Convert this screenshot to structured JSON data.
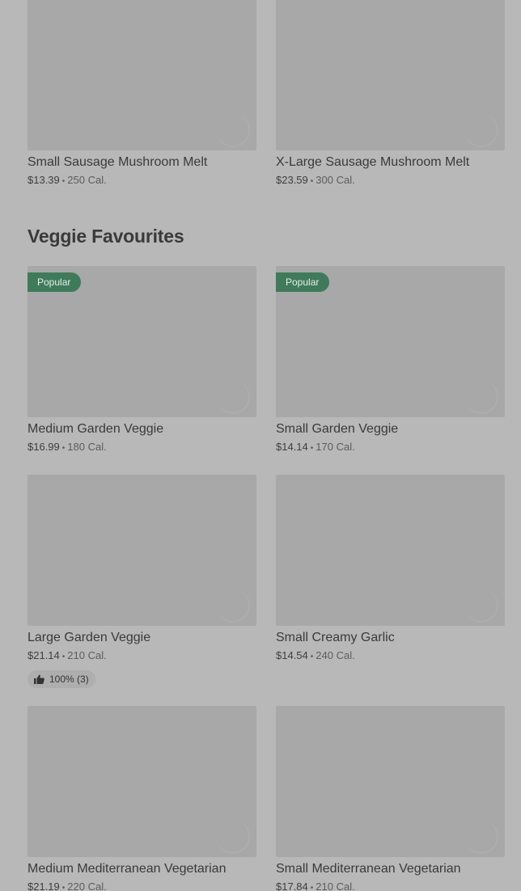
{
  "top_items": [
    {
      "name": "Small Sausage Mushroom Melt",
      "price": "$13.39",
      "calories": "250 Cal."
    },
    {
      "name": "X-Large Sausage Mushroom Melt",
      "price": "$23.59",
      "calories": "300 Cal."
    }
  ],
  "section": {
    "title": "Veggie Favourites"
  },
  "veggie_items": [
    {
      "name": "Medium Garden Veggie",
      "price": "$16.99",
      "calories": "180 Cal.",
      "badge": "Popular"
    },
    {
      "name": "Small Garden Veggie",
      "price": "$14.14",
      "calories": "170 Cal.",
      "badge": "Popular"
    },
    {
      "name": "Large Garden Veggie",
      "price": "$21.14",
      "calories": "210 Cal.",
      "rating": "100% (3)"
    },
    {
      "name": "Small Creamy Garlic",
      "price": "$14.54",
      "calories": "240 Cal."
    },
    {
      "name": "Medium Mediterranean Vegetarian",
      "price": "$21.19",
      "calories": "220 Cal."
    },
    {
      "name": "Small Mediterranean Vegetarian",
      "price": "$17.84",
      "calories": "210 Cal."
    }
  ],
  "separator": "•",
  "icons": {
    "rating": "thumbs-up-icon"
  },
  "colors": {
    "badge": "#3f7a5a",
    "background": "#b8b8b8",
    "image_placeholder": "#a8a8a8"
  }
}
